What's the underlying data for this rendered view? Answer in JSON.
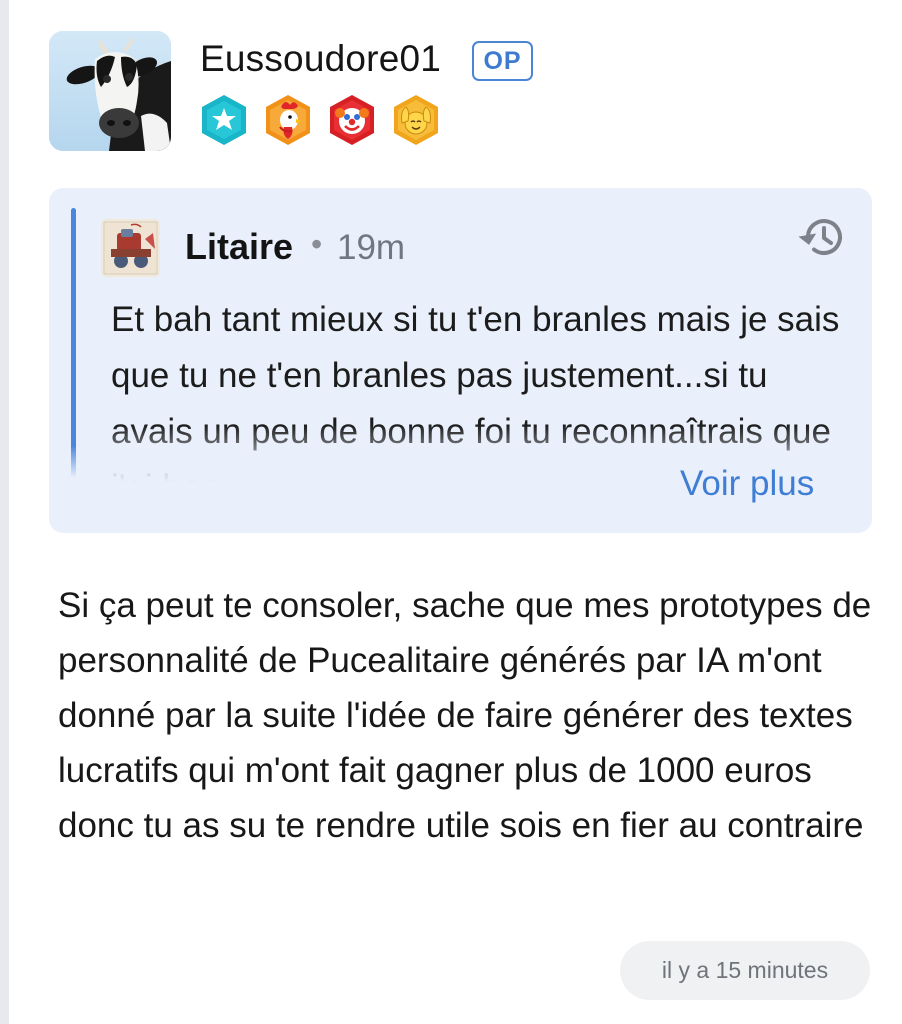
{
  "post": {
    "author": {
      "username": "Eussoudore01",
      "op_label": "OP",
      "avatar_icon": "cow-avatar",
      "badges": [
        {
          "icon": "star-hexagon-badge-icon",
          "color": "#19b6c9"
        },
        {
          "icon": "rooster-hexagon-badge-icon",
          "color": "#f29a1f"
        },
        {
          "icon": "clown-hexagon-badge-icon",
          "color": "#e02a2a"
        },
        {
          "icon": "raised-hands-hexagon-badge-icon",
          "color": "#f2b62a"
        }
      ]
    },
    "quote": {
      "author": "Litaire",
      "separator": "•",
      "time": "19m",
      "text": "Et bah tant mieux si tu t'en branles mais je sais que tu ne t'en branles pas justement...si tu avais un peu de bonne foi tu reconnaîtrais que j'ai bon",
      "see_more": "Voir plus",
      "history_icon": "history-icon",
      "accent_color": "#4a86dc",
      "background_color": "#e9f0fb"
    },
    "body": "Si ça peut te consoler, sache que mes prototypes de personnalité de Pucealitaire générés par IA m'ont donné par la suite l'idée de faire générer des textes lucratifs qui m'ont fait gagner plus de 1000 euros donc tu as su te rendre utile sois en fier au contraire",
    "timestamp": "il y a 15 minutes"
  }
}
